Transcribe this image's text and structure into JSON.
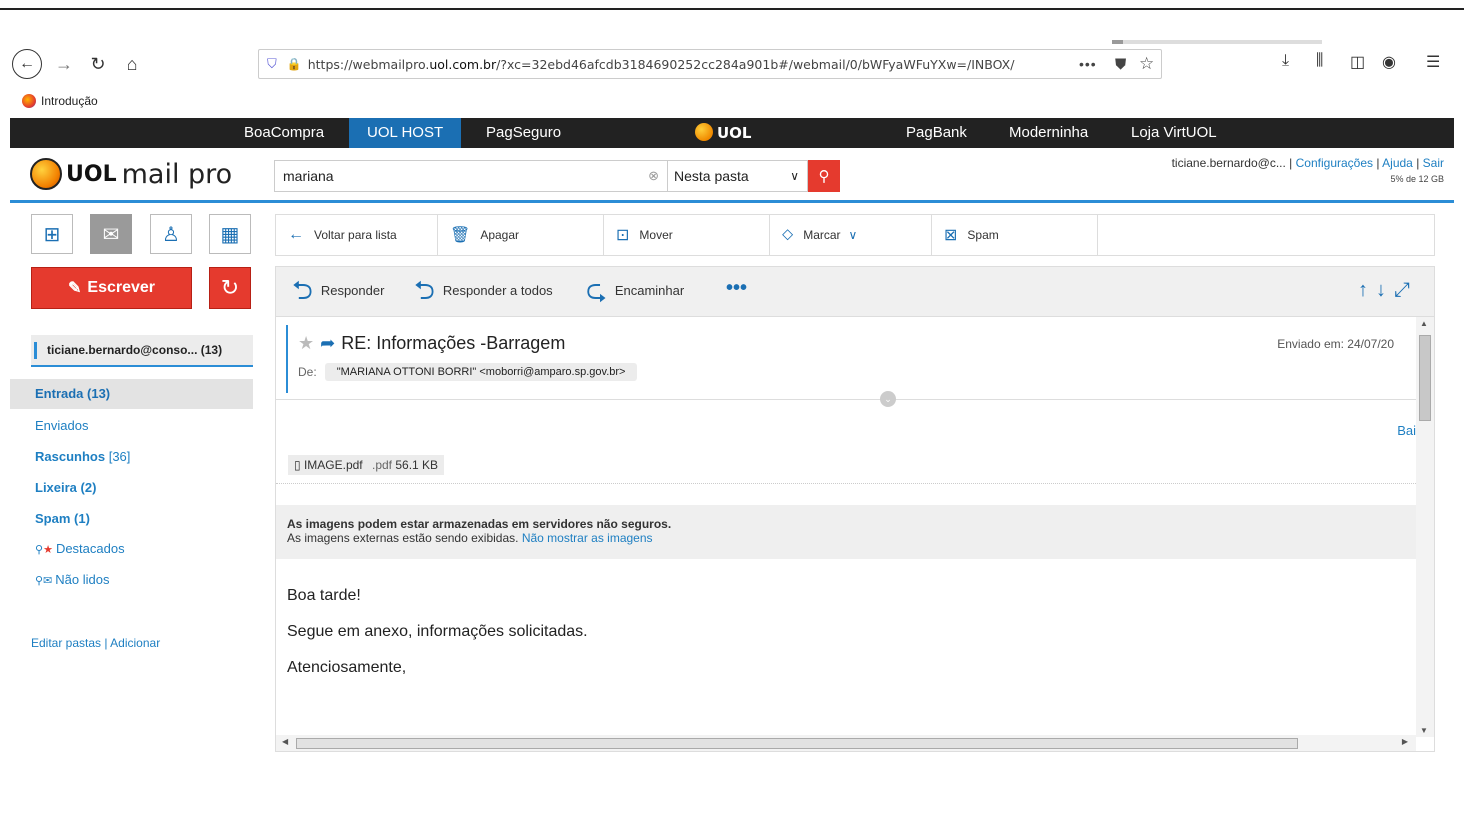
{
  "browser": {
    "url_prefix": "https://webmailpro.",
    "url_domain": "uol.com.br",
    "url_rest": "/?xc=32ebd46afcdb3184690252cc284a901b#/webmail/0/bWFyaWFuYXw=/INBOX/",
    "bookmark": "Introdução"
  },
  "uol_nav": {
    "items": [
      "BoaCompra",
      "UOL HOST",
      "PagSeguro",
      "UOL",
      "PagBank",
      "Moderninha",
      "Loja VirtUOL"
    ],
    "active": "UOL HOST"
  },
  "header": {
    "brand_uol": "UOL",
    "brand_product": "mail pro",
    "search_value": "mariana",
    "scope_value": "Nesta pasta",
    "account_email": "ticiane.bernardo@c...",
    "settings_link": "Configurações",
    "help_link": "Ajuda",
    "logout_link": "Sair",
    "quota_text": "5% de 12 GB",
    "quota_fraction": 0.05
  },
  "sidebar": {
    "compose_label": "Escrever",
    "account_label": "ticiane.bernardo@conso...",
    "account_count": "(13)",
    "folders": {
      "inbox": "Entrada (13)",
      "sent": "Enviados",
      "drafts": "Rascunhos",
      "drafts_count": "[36]",
      "trash": "Lixeira (2)",
      "spam": "Spam (1)",
      "starred": "Destacados",
      "unread": "Não lidos"
    },
    "edit_folders": "Editar pastas",
    "add_folder": "Adicionar"
  },
  "toolbar": {
    "back": "Voltar para lista",
    "delete": "Apagar",
    "move": "Mover",
    "mark": "Marcar",
    "spam": "Spam"
  },
  "actions": {
    "reply": "Responder",
    "reply_all": "Responder a todos",
    "forward": "Encaminhar"
  },
  "message": {
    "subject": "RE: Informações -Barragem",
    "from_label": "De:",
    "from": "\"MARIANA OTTONI BORRI\" <moborri@amparo.sp.gov.br>",
    "sent": "Enviado em: 24/07/20",
    "download_link": "Bai",
    "attachment_name": "IMAGE.pdf",
    "attachment_type": ".pdf",
    "attachment_size": "56.1 KB",
    "warning_title": "As imagens podem estar armazenadas em servidores não seguros.",
    "warning_text": "As imagens externas estão sendo exibidas.",
    "warning_link": "Não mostrar as imagens",
    "body": [
      "Boa tarde!",
      "Segue em anexo, informações solicitadas.",
      "Atenciosamente,"
    ]
  }
}
